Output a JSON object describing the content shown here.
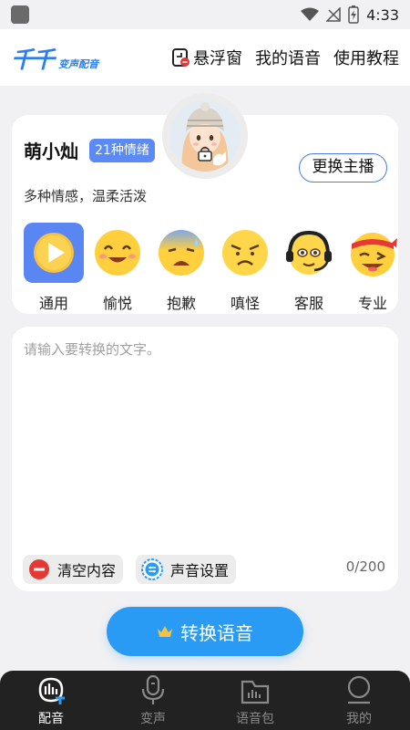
{
  "status": {
    "time": "4:33"
  },
  "header": {
    "logo_main": "千千",
    "logo_sub": "变声配音",
    "nav": [
      "悬浮窗",
      "我的语音",
      "使用教程"
    ]
  },
  "voice": {
    "name": "萌小灿",
    "emotion_count": "21种情绪",
    "change_button": "更换主播",
    "description": "多种情感，温柔活泼"
  },
  "emotions": [
    {
      "label": "通用",
      "icon": "play-icon",
      "selected": true
    },
    {
      "label": "愉悦",
      "icon": "smile-emoji-icon"
    },
    {
      "label": "抱歉",
      "icon": "sweat-emoji-icon"
    },
    {
      "label": "嗔怪",
      "icon": "annoyed-emoji-icon"
    },
    {
      "label": "客服",
      "icon": "headset-emoji-icon"
    },
    {
      "label": "专业",
      "icon": "wink-emoji-icon"
    }
  ],
  "editor": {
    "placeholder": "请输入要转换的文字。",
    "clear_label": "清空内容",
    "sound_settings_label": "声音设置",
    "counter": "0/200"
  },
  "convert": {
    "label": "转换语音"
  },
  "tabs": [
    {
      "label": "配音",
      "icon": "dubbing-icon",
      "active": true
    },
    {
      "label": "变声",
      "icon": "microphone-icon"
    },
    {
      "label": "语音包",
      "icon": "voice-pack-icon"
    },
    {
      "label": "我的",
      "icon": "profile-icon"
    }
  ],
  "colors": {
    "accent": "#2a9bf5",
    "badge": "#5b8af5",
    "tab_active": "#ffffff",
    "tab_inactive": "#8a8a8a"
  }
}
